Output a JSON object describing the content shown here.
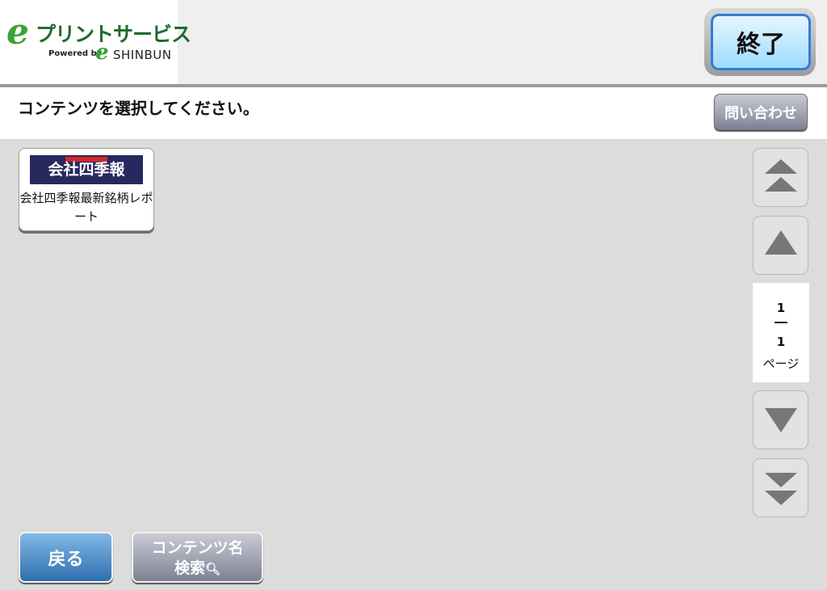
{
  "header": {
    "logo": {
      "mark": "e",
      "service_name": "プリントサービス",
      "powered_by": "Powered by",
      "brand_mark": "e",
      "brand_name": "SHINBUN"
    },
    "end_button": "終了"
  },
  "instruction": "コンテンツを選択してください。",
  "inquiry_button": "問い合わせ",
  "contents": [
    {
      "label": "会社四季報最新銘柄レポート",
      "thumbnail_title": "会社四季報"
    }
  ],
  "pagination": {
    "current": "1",
    "total": "1",
    "label": "ページ"
  },
  "footer": {
    "back_button": "戻る",
    "search_button_line1": "コンテンツ名",
    "search_button_line2": "検索",
    "search_icon": "magnifier-icon"
  },
  "colors": {
    "end_button_border": "#2d7fd8",
    "back_button": "#2e6fae",
    "logo_green": "#3aa437"
  }
}
